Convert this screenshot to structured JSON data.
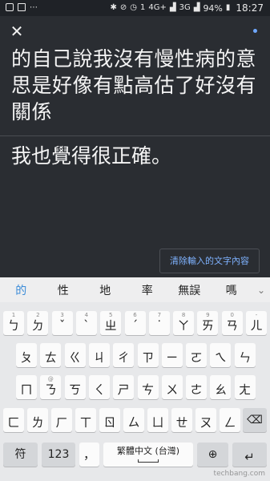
{
  "status_bar": {
    "left_icons": [
      "gallery-icon",
      "grid-icon",
      "dots-icon"
    ],
    "network_label": "4G+",
    "sim_label": "1",
    "net2_label": "3G",
    "battery": "94%",
    "time": "18:27"
  },
  "translate": {
    "upper_text": "的自己說我沒有慢性病的意思是好像有點高估了好沒有關係",
    "lower_text": "我也覺得很正確。",
    "clear_label": "清除輸入的文字內容"
  },
  "keyboard": {
    "suggestions": [
      "的",
      "性",
      "地",
      "率",
      "無誤",
      "嗎"
    ],
    "row1": [
      {
        "sub": "1",
        "main": "ㄅ"
      },
      {
        "sub": "2",
        "main": "ㄉ"
      },
      {
        "sub": "3",
        "main": "ˇ"
      },
      {
        "sub": "4",
        "main": "ˋ"
      },
      {
        "sub": "5",
        "main": "ㄓ"
      },
      {
        "sub": "6",
        "main": "ˊ"
      },
      {
        "sub": "7",
        "main": "˙"
      },
      {
        "sub": "8",
        "main": "ㄚ"
      },
      {
        "sub": "9",
        "main": "ㄞ"
      },
      {
        "sub": "0",
        "main": "ㄢ"
      },
      {
        "sub": "-",
        "main": "ㄦ"
      }
    ],
    "row2": [
      {
        "sub": "",
        "main": "ㄆ"
      },
      {
        "sub": "",
        "main": "ㄊ"
      },
      {
        "sub": "",
        "main": "ㄍ"
      },
      {
        "sub": "",
        "main": "ㄐ"
      },
      {
        "sub": "",
        "main": "ㄔ"
      },
      {
        "sub": "",
        "main": "ㄗ"
      },
      {
        "sub": "",
        "main": "ㄧ"
      },
      {
        "sub": "",
        "main": "ㄛ"
      },
      {
        "sub": "",
        "main": "ㄟ"
      },
      {
        "sub": "",
        "main": "ㄣ"
      }
    ],
    "row3": [
      {
        "sub": "",
        "main": "ㄇ"
      },
      {
        "sub": "@",
        "main": "ㄋ"
      },
      {
        "sub": "",
        "main": "ㄎ"
      },
      {
        "sub": "",
        "main": "ㄑ"
      },
      {
        "sub": "",
        "main": "ㄕ"
      },
      {
        "sub": "",
        "main": "ㄘ"
      },
      {
        "sub": "",
        "main": "ㄨ"
      },
      {
        "sub": "",
        "main": "ㄜ"
      },
      {
        "sub": "",
        "main": "ㄠ"
      },
      {
        "sub": "",
        "main": "ㄤ"
      }
    ],
    "row4": [
      {
        "sub": "",
        "main": "ㄈ"
      },
      {
        "sub": "",
        "main": "ㄌ"
      },
      {
        "sub": "",
        "main": "ㄏ"
      },
      {
        "sub": "",
        "main": "ㄒ"
      },
      {
        "sub": "",
        "main": "ㄖ"
      },
      {
        "sub": "",
        "main": "ㄙ"
      },
      {
        "sub": "",
        "main": "ㄩ"
      },
      {
        "sub": "",
        "main": "ㄝ"
      },
      {
        "sub": "",
        "main": "ㄡ"
      },
      {
        "sub": "",
        "main": "ㄥ"
      }
    ],
    "symbols_label": "符",
    "numbers_label": "123",
    "comma_label": "，",
    "space_label": "繁體中文 (台灣)",
    "globe_icon": "globe-icon",
    "backspace_icon": "backspace-icon",
    "enter_icon": "enter-icon"
  },
  "watermark": "techbang.com"
}
